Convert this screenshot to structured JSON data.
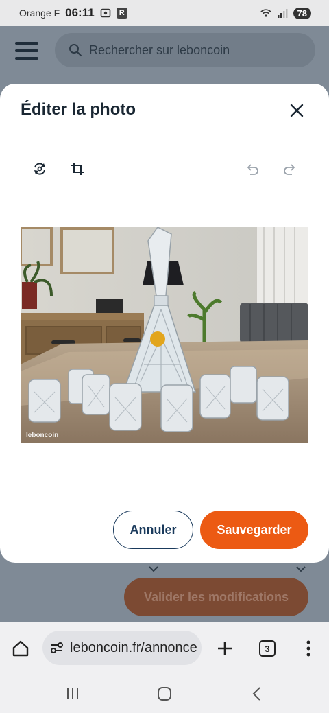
{
  "status_bar": {
    "carrier": "Orange F",
    "time": "06:11",
    "r_badge": "R",
    "battery": "78",
    "icons": [
      "screenshot-icon",
      "r-app-icon",
      "wifi-icon",
      "signal-icon",
      "battery-icon"
    ]
  },
  "header": {
    "search_placeholder": "Rechercher sur leboncoin",
    "menu_icon": "hamburger-icon",
    "search_icon": "search-icon"
  },
  "modal": {
    "title": "Éditer la photo",
    "tools": [
      "rotate-icon",
      "crop-icon",
      "undo-icon",
      "redo-icon"
    ],
    "photo_watermark": "leboncoin",
    "cancel_label": "Annuler",
    "save_label": "Sauvegarder"
  },
  "background": {
    "validate_label": "Valider les modifications"
  },
  "browser": {
    "url": "leboncoin.fr/annonce",
    "tab_count": "3",
    "icons": [
      "home-icon",
      "site-settings-icon",
      "new-tab-icon",
      "tabs-icon",
      "more-icon"
    ]
  },
  "nav": {
    "icons": [
      "recents-icon",
      "home-nav-icon",
      "back-icon"
    ]
  },
  "colors": {
    "accent": "#ec5a13",
    "navy": "#1a3a5c",
    "overlay": "#7f8a96"
  }
}
